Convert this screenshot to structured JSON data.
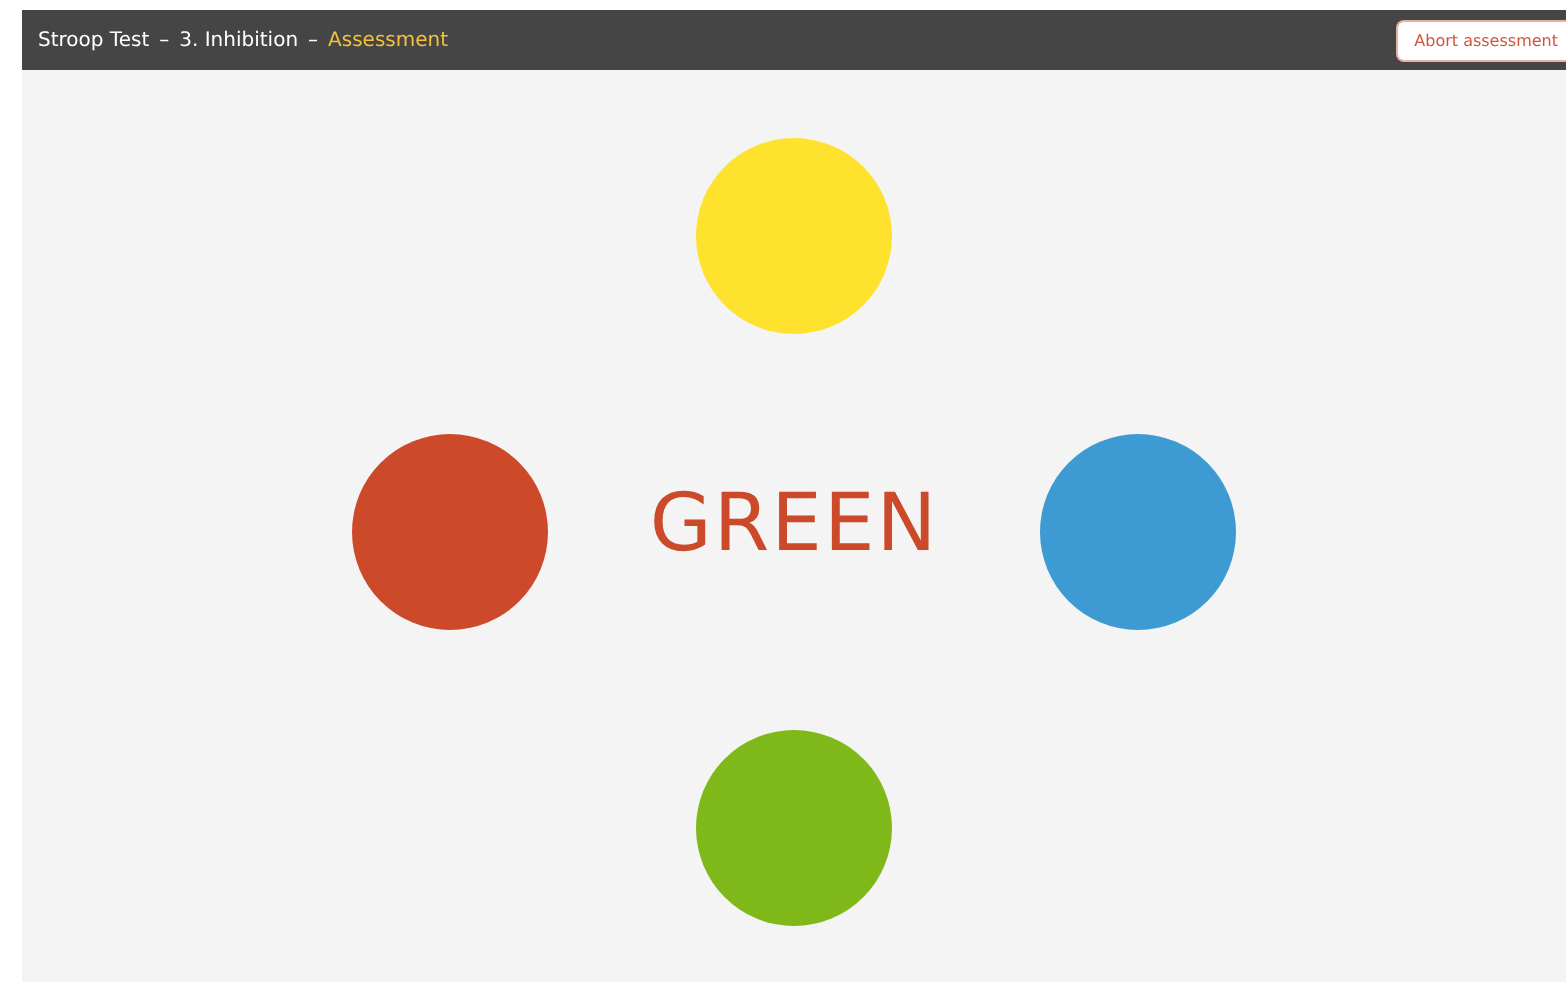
{
  "header": {
    "breadcrumb": [
      {
        "text": "Stroop Test",
        "current": false
      },
      {
        "text": "3. Inhibition",
        "current": false
      },
      {
        "text": "Assessment",
        "current": true
      }
    ],
    "separator": "–",
    "abort_button": "Abort assessment"
  },
  "stimulus": {
    "word": "GREEN",
    "color": "#cc4a2a"
  },
  "choices": [
    {
      "kind": "top",
      "color": "#ffe22e"
    },
    {
      "kind": "left",
      "color": "#cc4a2a"
    },
    {
      "kind": "right",
      "color": "#3d9ad3"
    },
    {
      "kind": "bottom",
      "color": "#7eb919"
    }
  ]
}
